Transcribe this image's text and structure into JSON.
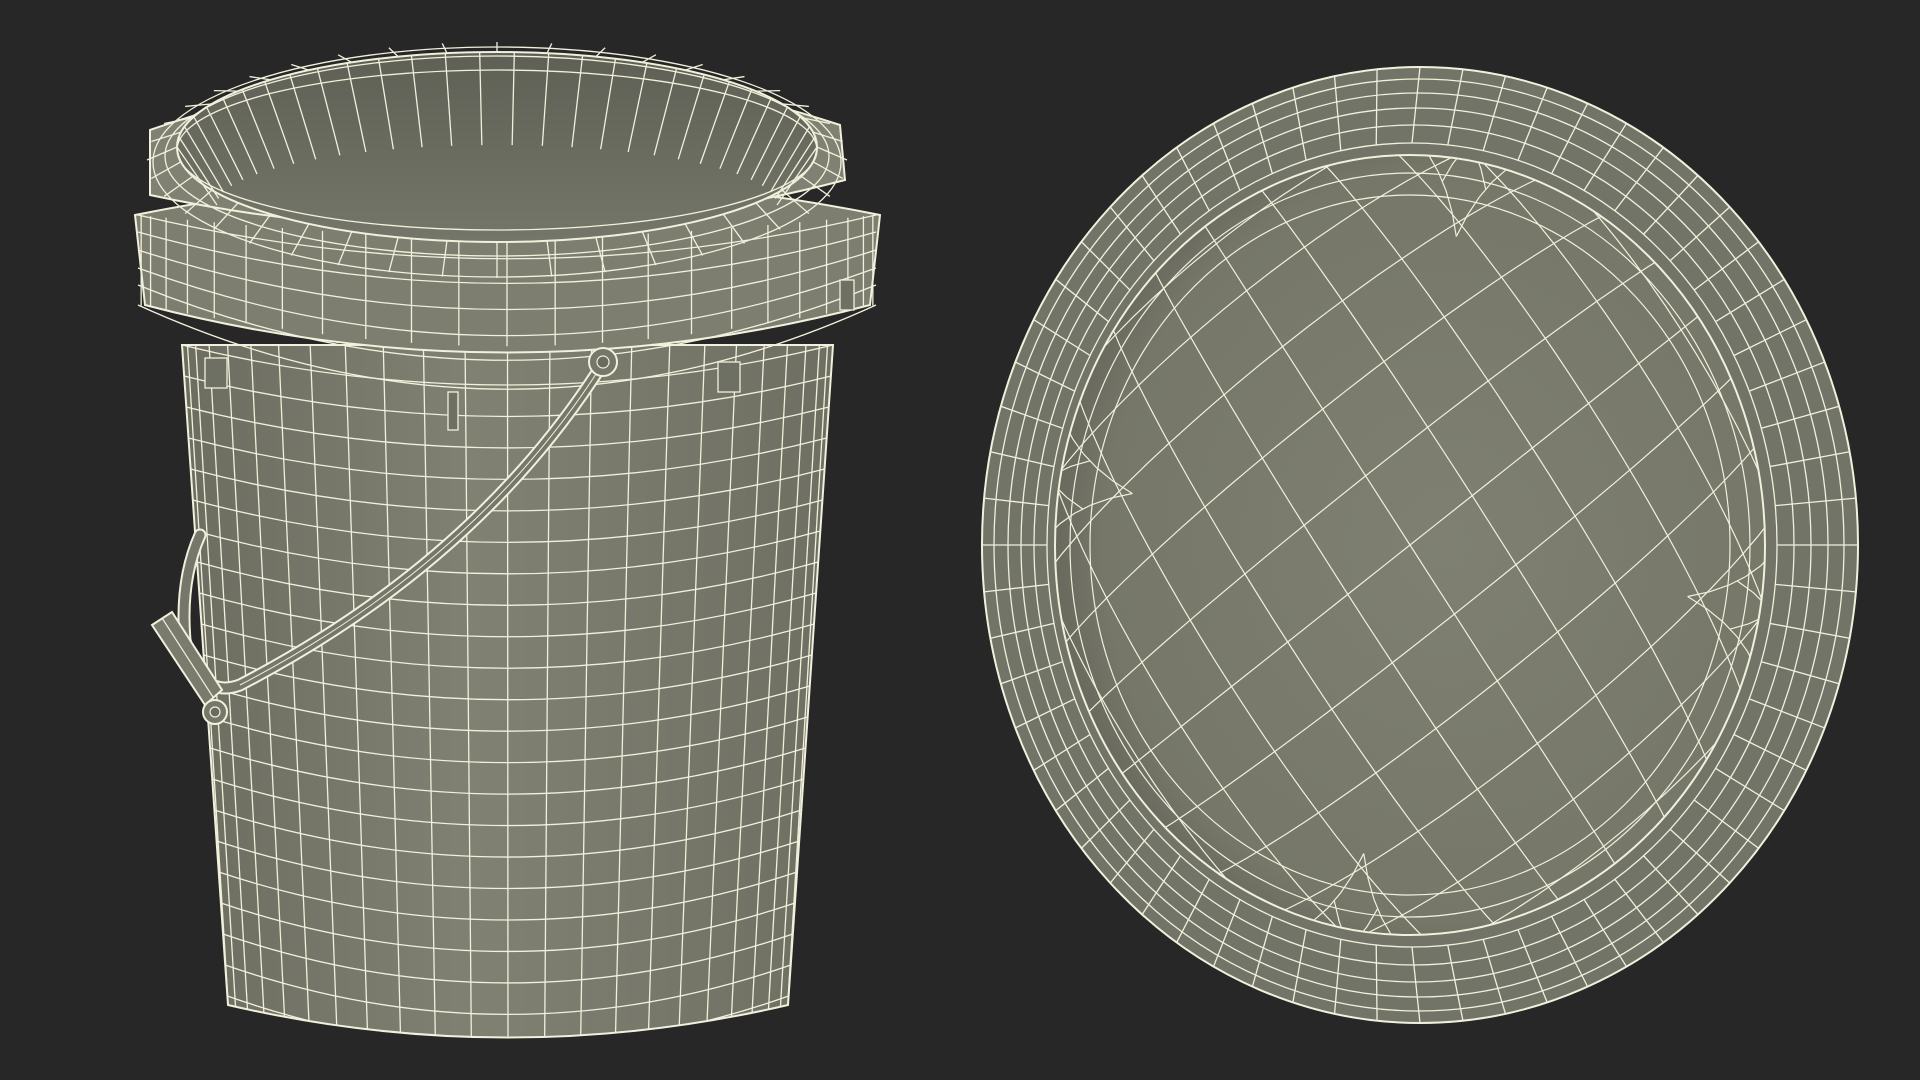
{
  "scene": {
    "background_color": "#272727",
    "surface_color": "#7a7b6d",
    "surface_dark_color": "#6a6b5e",
    "wire_color": "#f1f0dc",
    "objects": [
      {
        "name": "paint-bucket",
        "view": "perspective",
        "has_handle": true
      },
      {
        "name": "bucket-lid",
        "view": "top-down"
      }
    ]
  }
}
